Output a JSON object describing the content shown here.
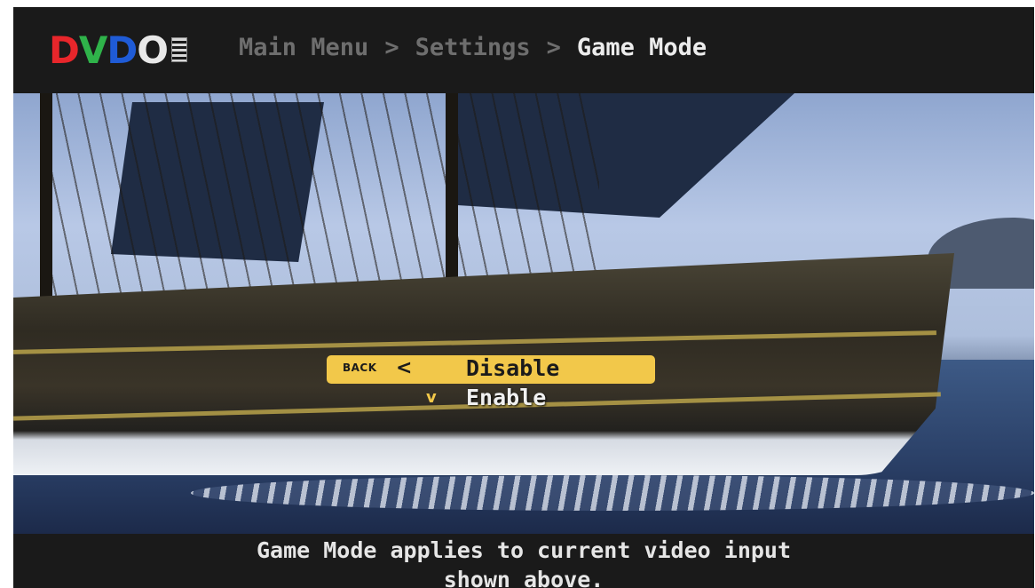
{
  "header": {
    "logo": {
      "l1": "D",
      "l2": "V",
      "l3": "D",
      "l4": "O"
    },
    "breadcrumb": {
      "items": [
        "Main Menu",
        "Settings",
        "Game Mode"
      ],
      "separator": ">"
    }
  },
  "menu": {
    "back_label": "BACK",
    "back_icon": "<",
    "options": [
      {
        "label": "Disable",
        "selected": true
      },
      {
        "label": "Enable",
        "selected": false
      }
    ],
    "down_icon": "v"
  },
  "footer": {
    "info_line1": "Game Mode applies to current video input",
    "info_line2": "shown above."
  },
  "colors": {
    "accent": "#f2c84a",
    "background": "#1a1a1a",
    "logo_d1": "#e8262b",
    "logo_v": "#2fb34a",
    "logo_d2": "#1f5bd6",
    "logo_o": "#e8e8e8"
  },
  "icons": [
    "back-chevron-icon",
    "chevron-down-icon",
    "dvdo-logo"
  ]
}
